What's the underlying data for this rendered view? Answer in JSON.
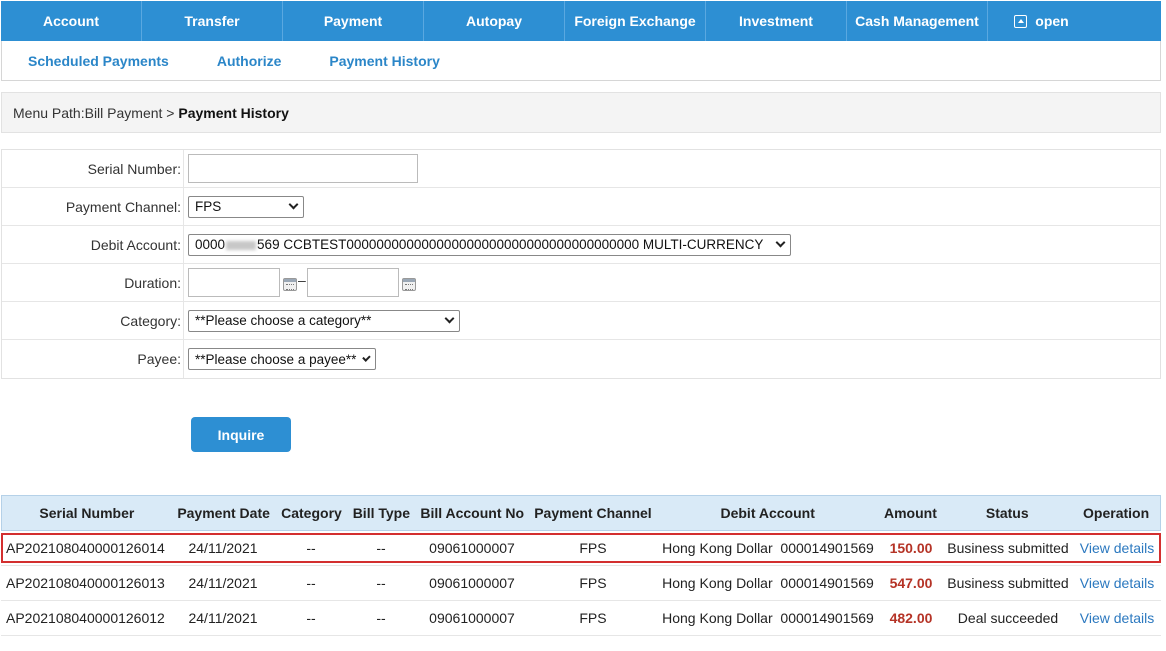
{
  "top_nav": {
    "items": [
      "Account",
      "Transfer",
      "Payment",
      "Autopay",
      "Foreign Exchange",
      "Investment",
      "Cash Management"
    ],
    "open_label": "open"
  },
  "sub_nav": {
    "items": [
      "Scheduled Payments",
      "Authorize",
      "Payment History"
    ]
  },
  "breadcrumb": {
    "prefix": "Menu Path:Bill Payment > ",
    "current": "Payment History"
  },
  "form": {
    "serial_label": "Serial Number:",
    "serial_value": "",
    "channel_label": "Payment Channel:",
    "channel_value": "FPS",
    "debit_label": "Debit Account:",
    "debit_value_prefix": "0000",
    "debit_value_suffix": "569 CCBTEST000000000000000000000000000000000000000 MULTI-CURRENCY",
    "duration_label": "Duration:",
    "duration_separator": "–",
    "category_label": "Category:",
    "category_value": "**Please choose a category**",
    "payee_label": "Payee:",
    "payee_value": "**Please choose a payee**"
  },
  "inquire_label": "Inquire",
  "table": {
    "headers": [
      "Serial Number",
      "Payment Date",
      "Category",
      "Bill Type",
      "Bill Account No",
      "Payment Channel",
      "Debit Account",
      "Amount",
      "Status",
      "Operation"
    ],
    "rows": [
      {
        "serial": "AP202108040000126014",
        "date": "24/11/2021",
        "category": "--",
        "bill_type": "--",
        "bill_account": "09061000007",
        "channel": "FPS",
        "debit": "Hong Kong Dollar  000014901569",
        "amount": "150.00",
        "status": "Business submitted",
        "operation": "View details"
      },
      {
        "serial": "AP202108040000126013",
        "date": "24/11/2021",
        "category": "--",
        "bill_type": "--",
        "bill_account": "09061000007",
        "channel": "FPS",
        "debit": "Hong Kong Dollar  000014901569",
        "amount": "547.00",
        "status": "Business submitted",
        "operation": "View details"
      },
      {
        "serial": "AP202108040000126012",
        "date": "24/11/2021",
        "category": "--",
        "bill_type": "--",
        "bill_account": "09061000007",
        "channel": "FPS",
        "debit": "Hong Kong Dollar  000014901569",
        "amount": "482.00",
        "status": "Deal succeeded",
        "operation": "View details"
      }
    ]
  },
  "colors": {
    "nav_blue": "#2d8fd3",
    "link_blue": "#2b86c8",
    "amount_red": "#b53326",
    "highlight_red": "#d32f2f",
    "header_bg": "#d9eaf7"
  }
}
